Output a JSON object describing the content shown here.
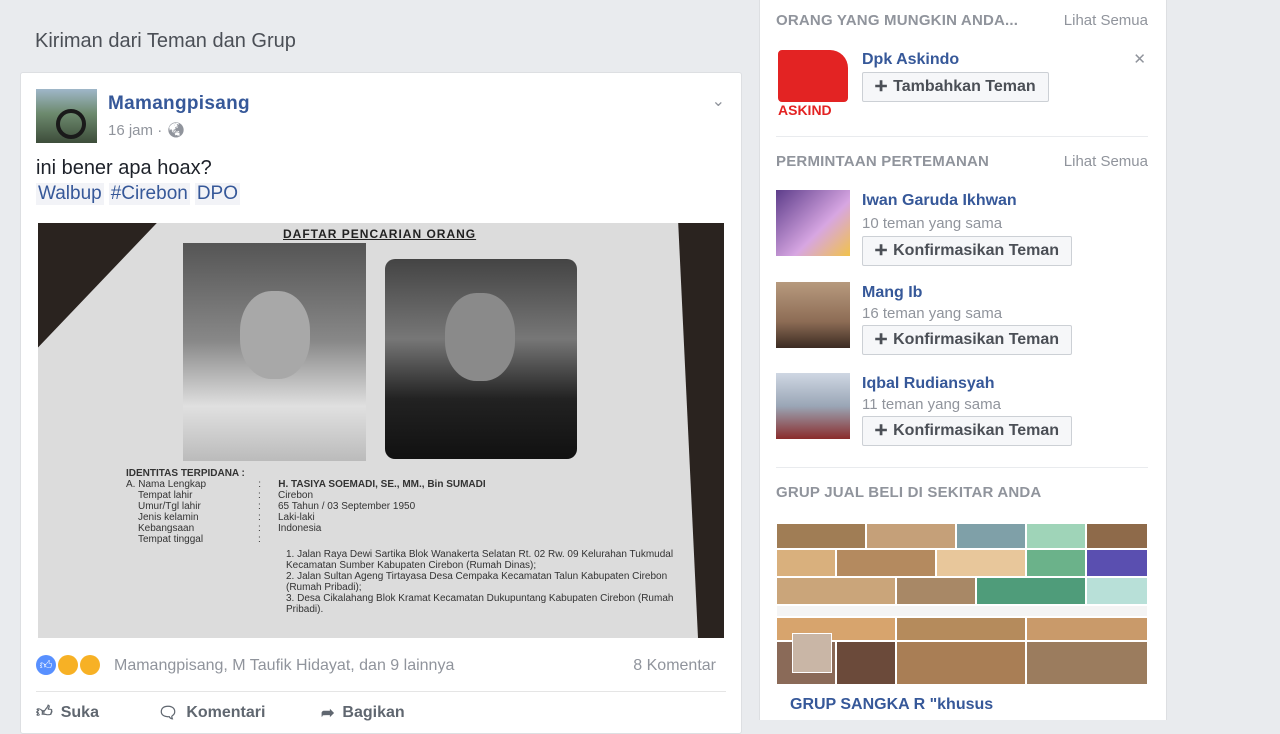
{
  "feed": {
    "section_title": "Kiriman dari Teman dan Grup"
  },
  "post": {
    "author": "Mamangpisang",
    "time": "16 jam",
    "text": "ini bener apa hoax?",
    "tags": [
      "Walbup",
      "#Cirebon",
      "DPO"
    ],
    "photo_doc": {
      "title": "DAFTAR PENCARIAN ORANG",
      "section": "IDENTITAS TERPIDANA :",
      "rows": [
        [
          "A.",
          "Nama Lengkap",
          ":",
          "H. TASIYA SOEMADI, SE., MM., Bin SUMADI"
        ],
        [
          "",
          "Tempat lahir",
          ":",
          "Cirebon"
        ],
        [
          "",
          "Umur/Tgl lahir",
          ":",
          "65 Tahun / 03 September 1950"
        ],
        [
          "",
          "Jenis kelamin",
          ":",
          "Laki-laki"
        ],
        [
          "",
          "Kebangsaan",
          ":",
          "Indonesia"
        ],
        [
          "",
          "Tempat tinggal",
          ":",
          ""
        ]
      ],
      "addresses": [
        "1. Jalan Raya Dewi Sartika Blok Wanakerta Selatan Rt. 02 Rw. 09 Kelurahan Tukmudal Kecamatan Sumber Kabupaten Cirebon (Rumah Dinas);",
        "2. Jalan Sultan Ageng Tirtayasa Desa Cempaka Kecamatan Talun Kabupaten Cirebon (Rumah Pribadi);",
        "3. Desa Cikalahang Blok Kramat Kecamatan Dukupuntang Kabupaten Cirebon (Rumah Pribadi)."
      ]
    },
    "reactors": "Mamangpisang, M Taufik Hidayat, dan 9 lainnya",
    "comments_count": "8 Komentar",
    "actions": {
      "like": "Suka",
      "comment": "Komentari",
      "share": "Bagikan"
    },
    "colors": {
      "like": "#5890ff",
      "haha": "#f7b125",
      "link": "#365899"
    }
  },
  "sidebar": {
    "pymk": {
      "heading": "ORANG YANG MUNGKIN ANDA...",
      "see_all": "Lihat Semua",
      "name": "Dpk Askindo",
      "button": "Tambahkan Teman",
      "logo_text": "ASKIND"
    },
    "requests": {
      "heading": "PERMINTAAN PERTEMANAN",
      "see_all": "Lihat Semua",
      "items": [
        {
          "name": "Iwan Garuda Ikhwan",
          "mutual": "10 teman yang sama",
          "button": "Konfirmasikan Teman"
        },
        {
          "name": "Mang Ib",
          "mutual": "16 teman yang sama",
          "button": "Konfirmasikan Teman"
        },
        {
          "name": "Iqbal Rudiansyah",
          "mutual": "11 teman yang sama",
          "button": "Konfirmasikan Teman"
        }
      ]
    },
    "groups": {
      "heading": "GRUP JUAL BELI DI SEKITAR ANDA",
      "group_name": "GRUP SANGKA R \"khusus"
    }
  }
}
